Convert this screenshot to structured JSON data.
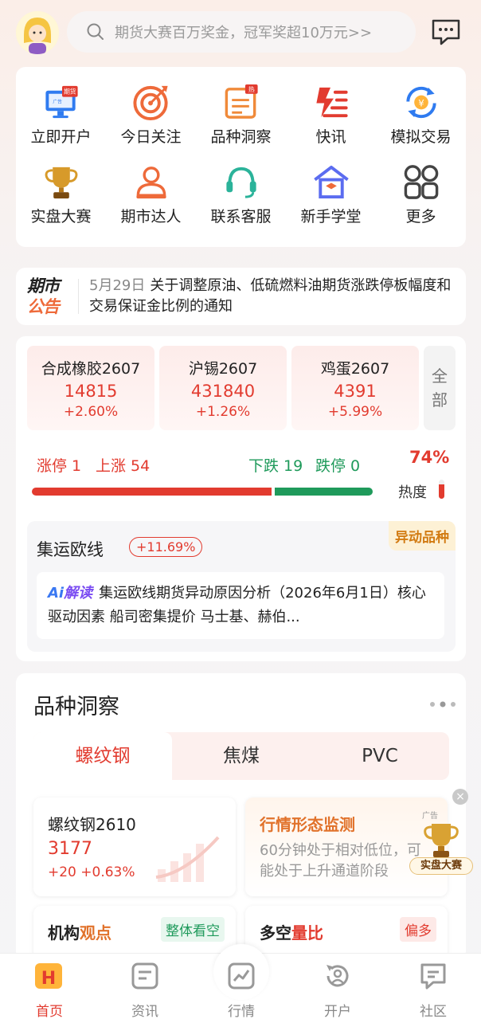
{
  "search": {
    "placeholder": "期货大赛百万奖金，冠军奖超10万元>>"
  },
  "grid": {
    "items": [
      {
        "label": "立即开户",
        "icon": "open-account-icon"
      },
      {
        "label": "今日关注",
        "icon": "target-icon"
      },
      {
        "label": "品种洞察",
        "icon": "insight-icon"
      },
      {
        "label": "快讯",
        "icon": "flash-news-icon"
      },
      {
        "label": "模拟交易",
        "icon": "simulated-trade-icon"
      },
      {
        "label": "实盘大赛",
        "icon": "trophy-icon"
      },
      {
        "label": "期市达人",
        "icon": "expert-icon"
      },
      {
        "label": "联系客服",
        "icon": "headset-icon"
      },
      {
        "label": "新手学堂",
        "icon": "school-icon"
      },
      {
        "label": "更多",
        "icon": "more-grid-icon"
      }
    ],
    "icon_badges": {
      "open_account": "期货",
      "open_account_sub": "广告",
      "insight_hot": "热"
    }
  },
  "notice": {
    "badge_line1": "期市",
    "badge_line2": "公告",
    "date": "5月29日",
    "text": "关于调整原油、低硫燃料油期货涨跌停板幅度和交易保证金比例的通知"
  },
  "quotes": [
    {
      "name": "合成橡胶2607",
      "price": "14815",
      "change": "+2.60%"
    },
    {
      "name": "沪锡2607",
      "price": "431840",
      "change": "+1.26%"
    },
    {
      "name": "鸡蛋2607",
      "price": "4391",
      "change": "+5.99%"
    }
  ],
  "all_button": {
    "line1": "全",
    "line2": "部"
  },
  "breadth": {
    "limit_up": "涨停 1",
    "up": "上涨 54",
    "down": "下跌 19",
    "limit_down": "跌停 0",
    "up_ratio": 0.71
  },
  "heat": {
    "value": "74%",
    "label": "热度",
    "level": 0.74
  },
  "anomaly": {
    "tag": "异动品种",
    "name": "集运欧线",
    "change": "+11.69%",
    "ai_a": "Ai",
    "ai_b": "解读",
    "ai_text": "集运欧线期货异动原因分析（2026年6月1日）核心驱动因素 船司密集提价 马士基、赫伯..."
  },
  "insight": {
    "title": "品种洞察",
    "tabs": [
      "螺纹钢",
      "焦煤",
      "PVC"
    ],
    "active_tab": 0,
    "card1": {
      "name": "螺纹钢2610",
      "price": "3177",
      "change": "+20  +0.63%"
    },
    "card2": {
      "title": "行情形态监测",
      "ad": "广告",
      "desc": "60分钟处于相对低位，可能处于上升通道阶段"
    },
    "card3": {
      "title_a": "机构",
      "title_b": "观点",
      "pill": "整体看空"
    },
    "card4": {
      "title_a": "多空",
      "title_b": "量比",
      "pill": "偏多"
    }
  },
  "float_badge": {
    "label": "实盘大赛"
  },
  "tabbar": [
    {
      "label": "首页",
      "icon": "home-icon",
      "active": true
    },
    {
      "label": "资讯",
      "icon": "news-icon",
      "active": false
    },
    {
      "label": "行情",
      "icon": "market-chart-icon",
      "active": false
    },
    {
      "label": "开户",
      "icon": "account-open-icon",
      "active": false
    },
    {
      "label": "社区",
      "icon": "community-icon",
      "active": false
    }
  ],
  "colors": {
    "up": "#e23b2f",
    "down": "#1f9a5b",
    "accent_orange": "#e1722b"
  }
}
